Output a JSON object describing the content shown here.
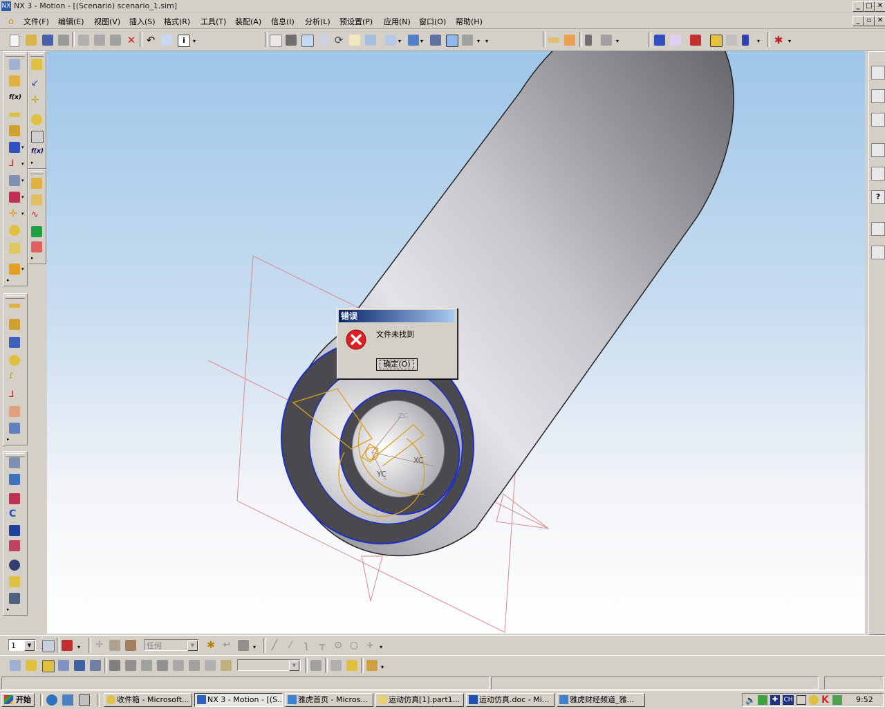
{
  "window": {
    "title": "NX 3 - Motion - [(Scenario) scenario_1.sim]",
    "logo_text": "NX"
  },
  "menu": {
    "items": [
      "文件(F)",
      "编辑(E)",
      "视图(V)",
      "插入(S)",
      "格式(R)",
      "工具(T)",
      "装配(A)",
      "信息(I)",
      "分析(L)",
      "预设置(P)",
      "应用(N)",
      "窗口(O)",
      "帮助(H)"
    ]
  },
  "viewport": {
    "axis_labels": {
      "xc": "XC",
      "yc": "YC",
      "zc": "ZC"
    },
    "colors": {
      "background_top": "#9ec6e8",
      "background_bottom": "#ffffff",
      "edge_highlight": "#1a2ecc",
      "datum_plane": "#d98a8a",
      "sketch": "#d9a020"
    }
  },
  "dialog": {
    "title": "错误",
    "message": "文件未找到",
    "ok_label": "确定(O)",
    "icon": "error-icon"
  },
  "bottom_toolbar": {
    "layer_value": "1",
    "filter_value": "任何",
    "snap_value": ""
  },
  "taskbar": {
    "start_label": "开始",
    "tasks": [
      {
        "label": "收件箱 - Microsoft...",
        "icon": "outlook-icon",
        "active": false
      },
      {
        "label": "NX 3 - Motion - [(S...",
        "icon": "nx-icon",
        "active": true
      },
      {
        "label": "雅虎首页 - Micros...",
        "icon": "ie-icon",
        "active": false
      },
      {
        "label": "运动仿真[1].part1...",
        "icon": "folder-icon",
        "active": false
      },
      {
        "label": "运动仿真.doc - Mi...",
        "icon": "word-icon",
        "active": false
      },
      {
        "label": "雅虎财经频道_雅...",
        "icon": "ie-icon",
        "active": false
      }
    ],
    "clock": "9:52",
    "ime": "CH"
  }
}
